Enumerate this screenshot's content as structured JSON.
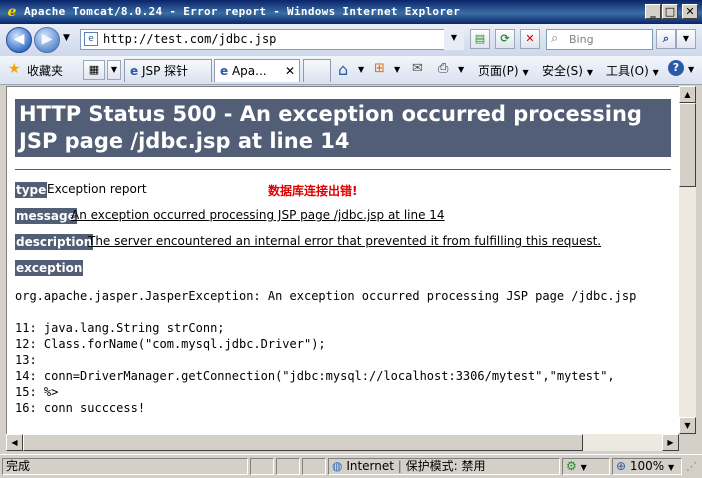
{
  "window": {
    "title": "Apache Tomcat/8.0.24 - Error report - Windows Internet Explorer",
    "min": "_",
    "max": "□",
    "close": "✕"
  },
  "nav": {
    "back": "◀",
    "forward": "▶",
    "address": "http://test.com/jdbc.jsp",
    "search_placeholder": "Bing"
  },
  "toolbar": {
    "favorites": "收藏夹",
    "tabs": [
      {
        "label": "JSP 探针"
      },
      {
        "label": "Apa..."
      }
    ],
    "page_menu": "页面(P)",
    "safety_menu": "安全(S)",
    "tools_menu": "工具(O)"
  },
  "page": {
    "heading": "HTTP Status 500 - An exception occurred processing JSP page /jdbc.jsp at line 14",
    "type_label": "type",
    "type_value": "Exception report",
    "error_text": "数据库连接出错!",
    "message_label": "message",
    "message_value": "An exception occurred processing JSP page /jdbc.jsp at line 14",
    "description_label": "description",
    "description_value": "The server encountered an internal error that prevented it from fulfilling this request.",
    "exception_label": "exception",
    "exception_line": "org.apache.jasper.JasperException: An exception occurred processing JSP page /jdbc.jsp",
    "code_lines": [
      "11: java.lang.String strConn;",
      "12: Class.forName(\"com.mysql.jdbc.Driver\");",
      "13: ",
      "14: conn=DriverManager.getConnection(\"jdbc:mysql://localhost:3306/mytest\",\"mytest\",",
      "15: %>",
      "16: conn succcess!"
    ]
  },
  "status": {
    "text": "完成",
    "zone": "Internet",
    "protected_mode": "保护模式: 禁用",
    "zoom": "100%"
  }
}
